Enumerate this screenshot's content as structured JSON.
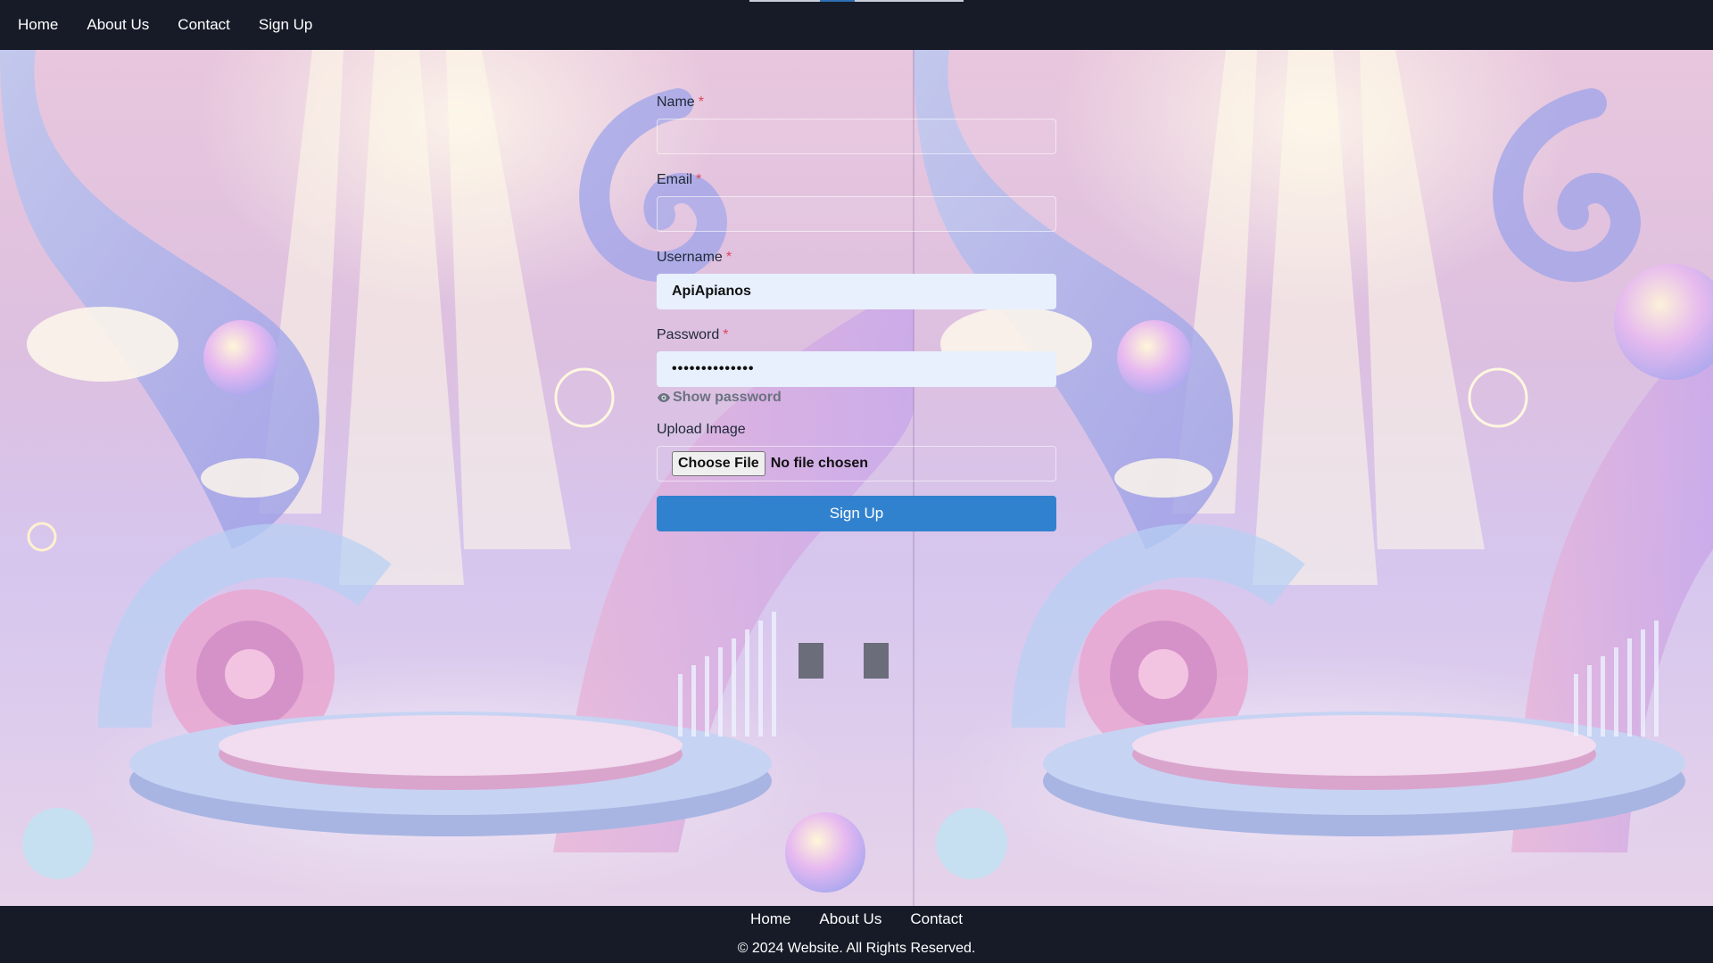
{
  "nav": {
    "links": [
      "Home",
      "About Us",
      "Contact",
      "Sign Up"
    ],
    "progress": {
      "total_fraction": 1.0,
      "filled_start_fraction": 0.33,
      "filled_end_fraction": 0.49
    }
  },
  "form": {
    "name": {
      "label": "Name",
      "required_mark": "*",
      "value": ""
    },
    "email": {
      "label": "Email",
      "required_mark": "*",
      "value": ""
    },
    "username": {
      "label": "Username",
      "required_mark": "*",
      "value": "ApiApianos"
    },
    "password": {
      "label": "Password",
      "required_mark": "*",
      "value": "••••••••••••••"
    },
    "show_password": {
      "label": "Show password",
      "icon": "eye-icon"
    },
    "upload": {
      "label": "Upload Image",
      "button": "Choose File",
      "status": "No file chosen"
    },
    "submit_label": "Sign Up"
  },
  "footer": {
    "links": [
      "Home",
      "About Us",
      "Contact"
    ],
    "copyright": "© 2024 Website. All Rights Reserved."
  },
  "colors": {
    "nav_bg": "#161b27",
    "primary": "#3182ce",
    "required": "#e0455a",
    "autofill_bg": "#e8f0fe"
  }
}
